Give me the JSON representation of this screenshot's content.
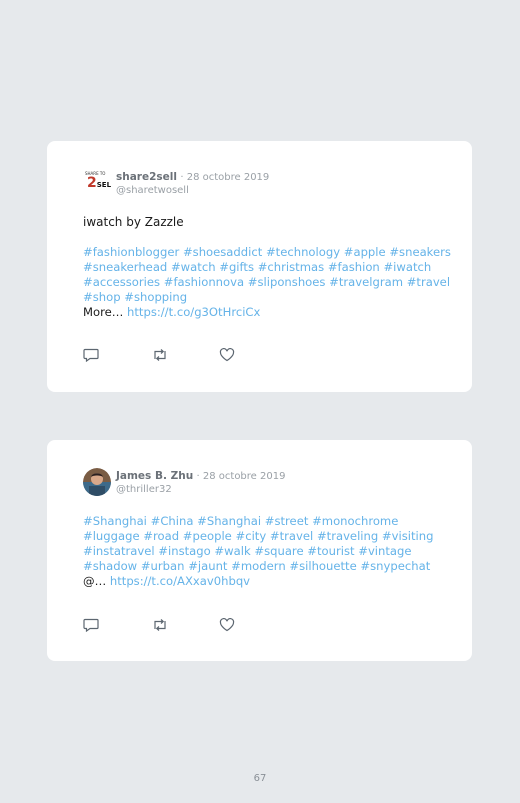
{
  "tweets": [
    {
      "author": "share2sell",
      "date": "· 28 octobre 2019",
      "handle": "@sharetwosell",
      "logo": {
        "top_text": "SHARE TO",
        "main_text_a": "2",
        "main_text_b": "SELL"
      },
      "title": "iwatch by Zazzle",
      "hashtags": [
        "#fashionblogger",
        "#shoesaddict",
        "#technology",
        "#apple",
        "#sneakers",
        "#sneakerhead",
        "#watch",
        "#gifts",
        "#christmas",
        "#fashion",
        "#iwatch",
        "#accessories",
        "#fashionnova",
        "#sliponshoes",
        "#travelgram",
        "#travel",
        "#shop",
        "#shopping"
      ],
      "more_label": "More…",
      "link": "https://t.co/g3OtHrciCx"
    },
    {
      "author": "James B. Zhu",
      "date": "· 28 octobre 2019",
      "handle": "@thriller32",
      "hashtags": [
        "#Shanghai",
        "#China",
        "#Shanghai",
        "#street",
        "#monochrome",
        "#luggage",
        "#road",
        "#people",
        "#city",
        "#travel",
        "#traveling",
        "#visiting",
        "#instatravel",
        "#instago",
        "#walk",
        "#square",
        "#tourist",
        "#vintage",
        "#shadow",
        "#urban",
        "#jaunt",
        "#modern",
        "#silhouette",
        "#snypechat"
      ],
      "more_label": "@…",
      "link": "https://t.co/AXxav0hbqv"
    }
  ],
  "icons": [
    "reply-icon",
    "retweet-icon",
    "like-icon"
  ],
  "colors": {
    "background": "#e6e9ec",
    "card": "#ffffff",
    "link": "#65b3e8",
    "muted": "#9aa0a6"
  },
  "page_number": "67"
}
